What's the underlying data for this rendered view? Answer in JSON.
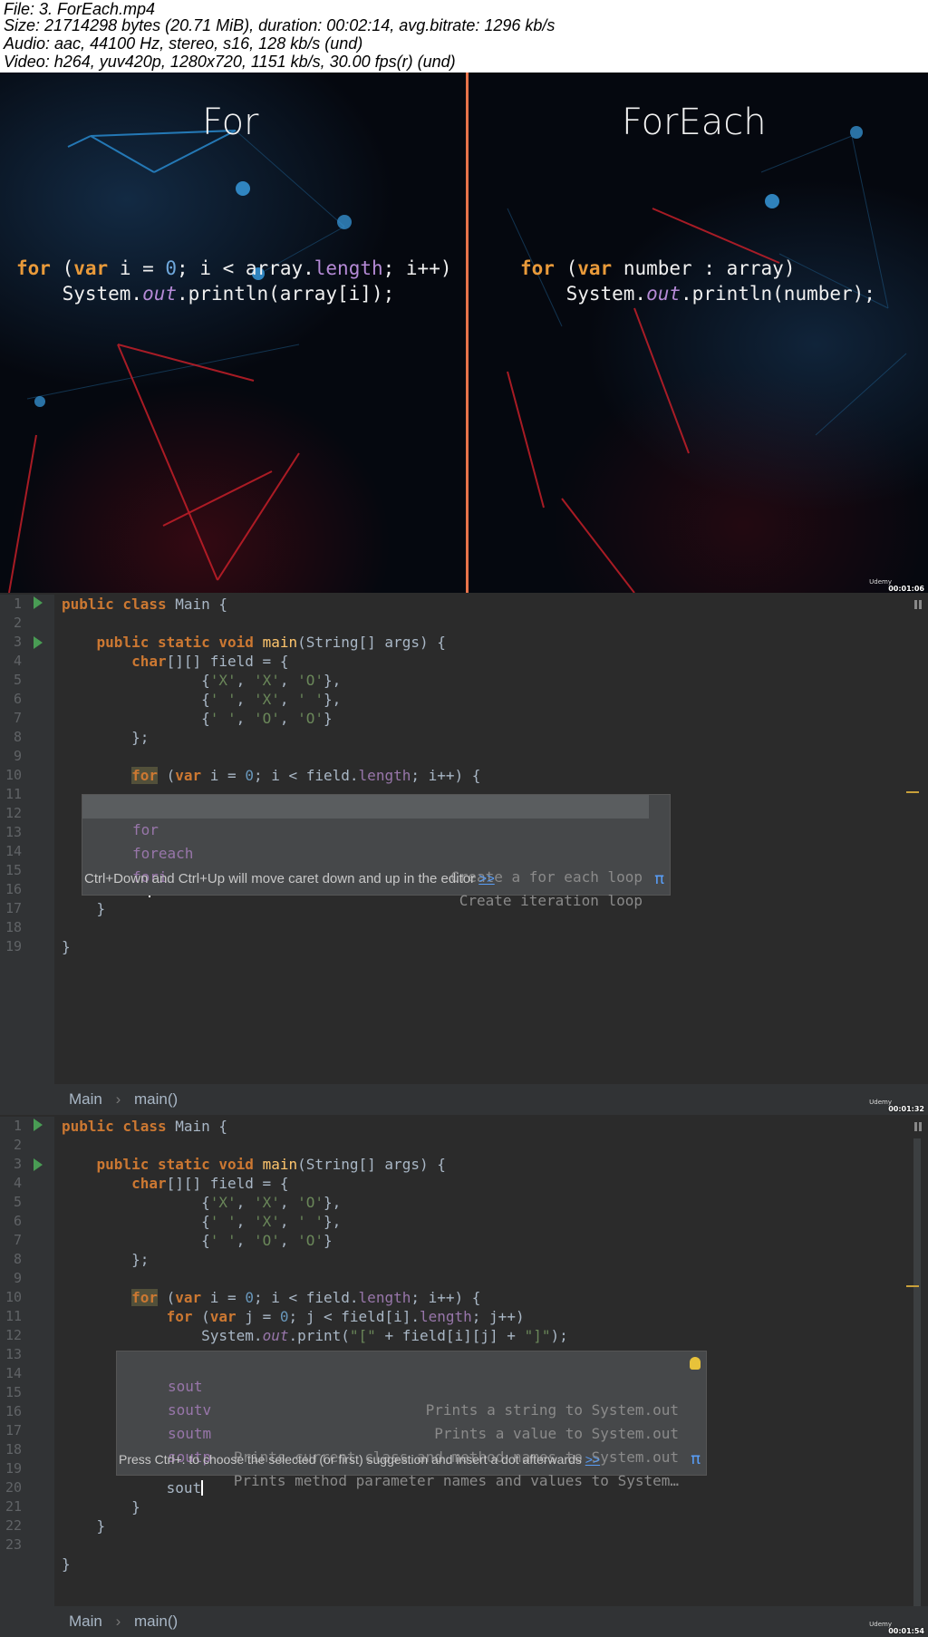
{
  "header": {
    "line1": "File: 3. ForEach.mp4",
    "line2": "Size: 21714298 bytes (20.71 MiB), duration: 00:02:14, avg.bitrate: 1296 kb/s",
    "line3": "Audio: aac, 44100 Hz, stereo, s16, 128 kb/s (und)",
    "line4": "Video: h264, yuv420p, 1280x720, 1151 kb/s, 30.00 fps(r) (und)"
  },
  "frame1": {
    "title_left": "For",
    "title_right": "ForEach",
    "timestamp": "00:01:06",
    "logo": "Udemy"
  },
  "frame2": {
    "timestamp": "00:01:32",
    "logo": "Udemy",
    "line_numbers": [
      "1",
      "2",
      "3",
      "4",
      "5",
      "6",
      "7",
      "8",
      "9",
      "10",
      "11",
      "12",
      "13",
      "14",
      "15",
      "16",
      "17",
      "18",
      "19"
    ],
    "popup": {
      "items": [
        {
          "name": "for",
          "desc": ""
        },
        {
          "name": "foreach",
          "desc": "Create a for each loop"
        },
        {
          "name": "fori",
          "desc": "Create iteration loop"
        }
      ],
      "tip": "Ctrl+Down and Ctrl+Up will move caret down and up in the editor",
      "tip_link": ">>",
      "pi": "π"
    },
    "typed": "fo",
    "breadcrumb": {
      "class": "Main",
      "sep": "›",
      "method": "main()"
    }
  },
  "frame3": {
    "timestamp": "00:01:54",
    "logo": "Udemy",
    "line_numbers": [
      "1",
      "2",
      "3",
      "4",
      "5",
      "6",
      "7",
      "8",
      "9",
      "10",
      "11",
      "12",
      "13",
      "14",
      "15",
      "16",
      "17",
      "18",
      "19",
      "20",
      "21",
      "22",
      "23"
    ],
    "popup": {
      "items": [
        {
          "name": "sout",
          "desc": "Prints a string to System.out"
        },
        {
          "name": "soutv",
          "desc": "Prints a value to System.out"
        },
        {
          "name": "soutm",
          "desc": "Prints current class and method names to System.out"
        },
        {
          "name": "soutp",
          "desc": "Prints method parameter names and values to System…"
        }
      ],
      "tip": "Press Ctrl+. to choose the selected (or first) suggestion and insert a dot afterwards",
      "tip_link": ">>",
      "pi": "π"
    },
    "typed": "sout",
    "breadcrumb": {
      "class": "Main",
      "sep": "›",
      "method": "main()"
    }
  },
  "colors": {
    "editor_bg": "#2b2b2b",
    "keyword": "#cc7832",
    "string": "#6a8759",
    "number": "#6897bb",
    "field": "#9876aa",
    "method": "#ffc66d"
  }
}
